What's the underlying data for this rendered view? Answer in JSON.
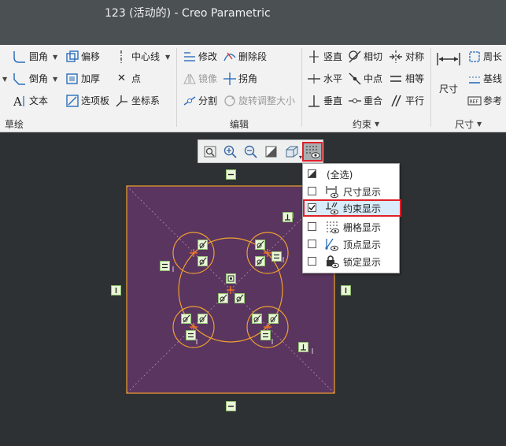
{
  "window": {
    "title": "123 (活动的) - Creo Parametric"
  },
  "ribbon": {
    "sketch_group": {
      "label": "草绘",
      "items": [
        {
          "label": "圆角",
          "icon": "fillet-icon",
          "has_menu": true
        },
        {
          "label": "偏移",
          "icon": "offset-icon"
        },
        {
          "label": "中心线",
          "icon": "centerline-icon",
          "has_menu": true
        },
        {
          "label": "倒角",
          "icon": "chamfer-icon",
          "has_menu": true
        },
        {
          "label": "加厚",
          "icon": "thicken-icon"
        },
        {
          "label": "点",
          "icon": "point-icon"
        },
        {
          "label": "文本",
          "icon": "text-icon"
        },
        {
          "label": "选项板",
          "icon": "palette-icon"
        },
        {
          "label": "坐标系",
          "icon": "coordinate-system-icon"
        }
      ]
    },
    "edit_group": {
      "label": "编辑",
      "items": [
        {
          "label": "修改",
          "icon": "modify-icon"
        },
        {
          "label": "删除段",
          "icon": "delete-segment-icon"
        },
        {
          "label": "镜像",
          "icon": "mirror-icon",
          "disabled": true
        },
        {
          "label": "拐角",
          "icon": "corner-icon"
        },
        {
          "label": "分割",
          "icon": "divide-icon"
        },
        {
          "label": "旋转调整大小",
          "icon": "rotate-resize-icon",
          "disabled": true
        }
      ]
    },
    "constrain_group": {
      "label": "约束",
      "items": [
        {
          "label": "竖直",
          "icon": "vertical-icon"
        },
        {
          "label": "相切",
          "icon": "tangent-icon"
        },
        {
          "label": "对称",
          "icon": "symmetric-icon"
        },
        {
          "label": "水平",
          "icon": "horizontal-icon"
        },
        {
          "label": "中点",
          "icon": "midpoint-icon"
        },
        {
          "label": "相等",
          "icon": "equal-icon"
        },
        {
          "label": "垂直",
          "icon": "perpendicular-icon"
        },
        {
          "label": "重合",
          "icon": "coincident-icon"
        },
        {
          "label": "平行",
          "icon": "parallel-icon"
        }
      ]
    },
    "dimension_group": {
      "label": "尺寸",
      "items": [
        {
          "label": "尺寸",
          "icon": "dimension-icon"
        },
        {
          "label": "周长",
          "icon": "perimeter-icon"
        },
        {
          "label": "基线",
          "icon": "baseline-icon"
        },
        {
          "label": "参考",
          "icon": "reference-icon"
        }
      ]
    }
  },
  "view_toolbar": {
    "buttons": [
      "refit-icon",
      "zoom-in-icon",
      "zoom-out-icon",
      "repaint-icon",
      "display-style-icon",
      "sketcher-display-filter-icon"
    ]
  },
  "display_filter_menu": {
    "items": [
      {
        "label": "(全选)",
        "checked": "partial",
        "icon": "select-all-icon"
      },
      {
        "label": "尺寸显示",
        "checked": false,
        "icon": "dimension-display-icon"
      },
      {
        "label": "约束显示",
        "checked": true,
        "icon": "constraint-display-icon",
        "highlighted": true
      },
      {
        "label": "栅格显示",
        "checked": false,
        "icon": "grid-display-icon"
      },
      {
        "label": "顶点显示",
        "checked": false,
        "icon": "vertex-display-icon"
      },
      {
        "label": "锁定显示",
        "checked": false,
        "icon": "lock-display-icon"
      }
    ]
  },
  "colors": {
    "sketch_fill": "#5a3560",
    "sketch_edge": "#f0a030",
    "constraint_symbol": "#eaf6d8",
    "highlight_border": "#e0202a"
  }
}
